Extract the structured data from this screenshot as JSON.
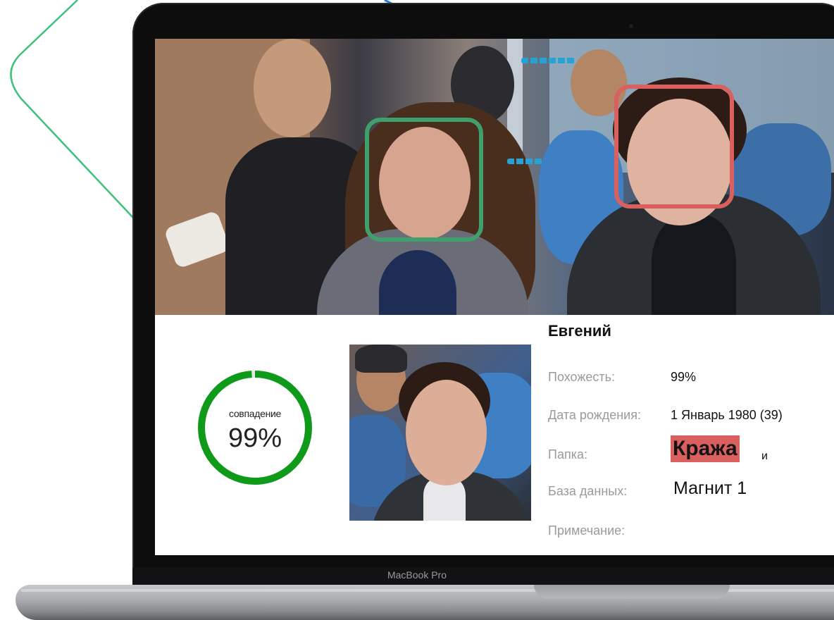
{
  "device": {
    "brand_label": "MacBook Pro"
  },
  "camera_feed": {
    "detections": [
      {
        "color": "#3fa06d",
        "status": "unmatched"
      },
      {
        "color": "#d9605e",
        "status": "matched"
      }
    ]
  },
  "match": {
    "ring_label": "совпадение",
    "score": "99%",
    "score_fraction": 0.99,
    "ring_color": "#0f9a1a",
    "name": "Евгений",
    "fields": {
      "similarity_label": "Похожесть:",
      "similarity_value": "99%",
      "birth_label": "Дата рождения:",
      "birth_value": "1 Январь 1980 (39)",
      "folder_label": "Папка:",
      "folder_value": "Кража",
      "folder_suffix": "и",
      "folder_color": "#d9605e",
      "database_label": "База данных:",
      "database_value": "Магнит 1",
      "note_label": "Примечание:"
    }
  },
  "decoration": {
    "accent_color": "#3fc07e"
  }
}
